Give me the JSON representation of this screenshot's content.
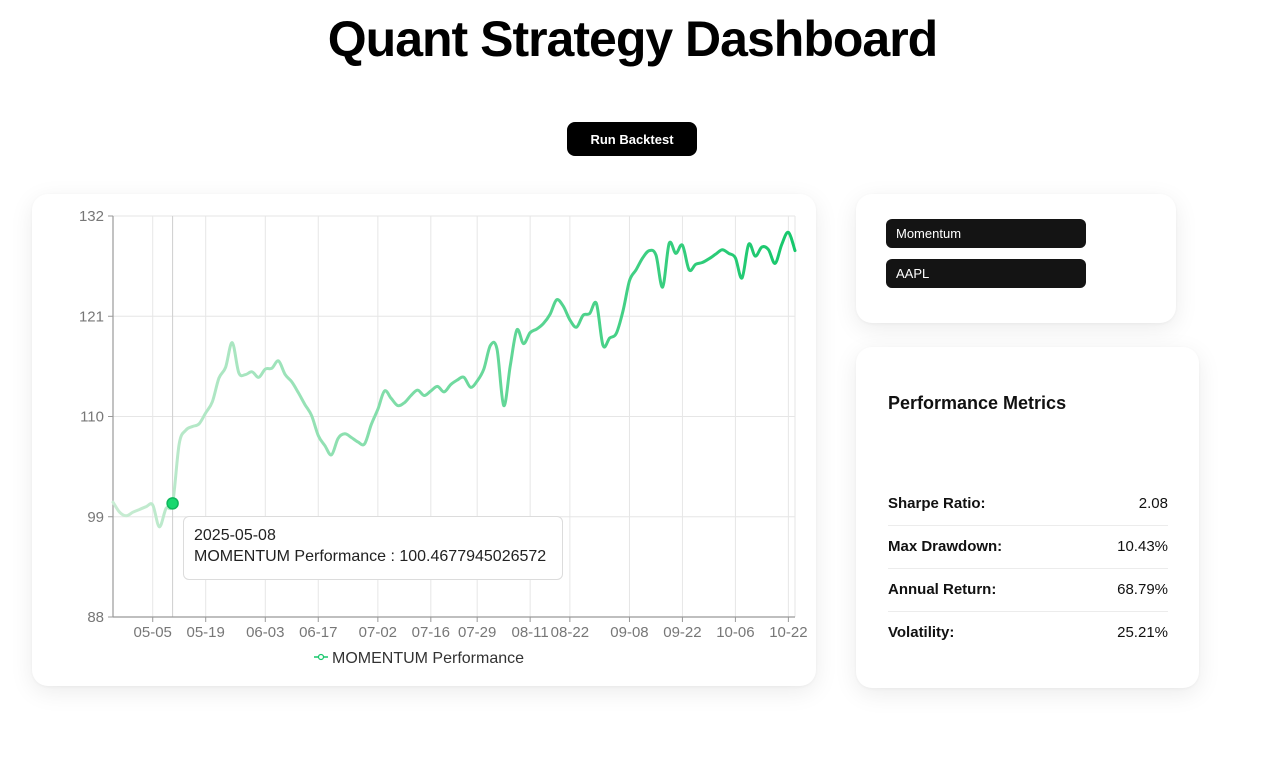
{
  "page": {
    "title": "Quant Strategy Dashboard"
  },
  "toolbar": {
    "run_label": "Run Backtest"
  },
  "selectors": {
    "strategy": "Momentum",
    "ticker": "AAPL"
  },
  "metrics": {
    "title": "Performance Metrics",
    "rows": [
      {
        "label": "Sharpe Ratio:",
        "value": "2.08"
      },
      {
        "label": "Max Drawdown:",
        "value": "10.43%"
      },
      {
        "label": "Annual Return:",
        "value": "68.79%"
      },
      {
        "label": "Volatility:",
        "value": "25.21%"
      }
    ]
  },
  "tooltip": {
    "date": "2025-05-08",
    "text": "MOMENTUM Performance : 100.4677945026572"
  },
  "colors": {
    "line_start": "#c9ecd3",
    "line_end": "#16c76b",
    "active_dot": "#18d86f",
    "grid": "#e6e6e6",
    "axis": "#999999"
  },
  "chart_data": {
    "type": "line",
    "title": "",
    "xlabel": "",
    "ylabel": "",
    "ylim": [
      88,
      132
    ],
    "yticks": [
      88,
      99,
      110,
      121,
      132
    ],
    "xtick_labels": [
      "05-05",
      "05-19",
      "06-03",
      "06-17",
      "07-02",
      "07-16",
      "07-29",
      "08-11",
      "08-22",
      "09-08",
      "09-22",
      "10-06",
      "10-22"
    ],
    "xtick_positions": [
      6,
      14,
      23,
      31,
      40,
      48,
      55,
      63,
      69,
      78,
      86,
      94,
      102
    ],
    "grid": true,
    "legend": "bottom-center",
    "highlight_index": 9,
    "series": [
      {
        "name": "MOMENTUM Performance",
        "values": [
          100.6,
          99.5,
          99.1,
          99.5,
          99.8,
          100.1,
          100.3,
          97.9,
          99.9,
          100.47,
          107.0,
          108.5,
          108.9,
          109.2,
          110.4,
          111.6,
          114.2,
          115.4,
          118.1,
          114.8,
          114.6,
          114.9,
          114.3,
          115.2,
          115.3,
          116.1,
          114.6,
          113.8,
          112.6,
          111.3,
          110.1,
          107.9,
          106.8,
          105.8,
          107.6,
          108.1,
          107.7,
          107.2,
          107.0,
          109.1,
          110.8,
          112.8,
          112.0,
          111.2,
          111.5,
          112.3,
          112.9,
          112.3,
          112.8,
          113.3,
          112.7,
          113.5,
          114.0,
          114.3,
          113.2,
          113.9,
          115.2,
          117.8,
          117.4,
          111.2,
          115.6,
          119.5,
          118.0,
          119.2,
          119.6,
          120.2,
          121.2,
          122.8,
          122.1,
          120.6,
          119.8,
          121.1,
          121.3,
          122.4,
          117.8,
          118.6,
          119.1,
          121.5,
          124.9,
          126.1,
          127.4,
          128.2,
          127.7,
          124.2,
          129.0,
          127.9,
          128.8,
          126.1,
          126.7,
          126.9,
          127.3,
          127.8,
          128.3,
          127.9,
          127.4,
          125.2,
          128.9,
          127.6,
          128.6,
          128.3,
          126.8,
          128.9,
          130.2,
          128.2
        ]
      }
    ]
  }
}
